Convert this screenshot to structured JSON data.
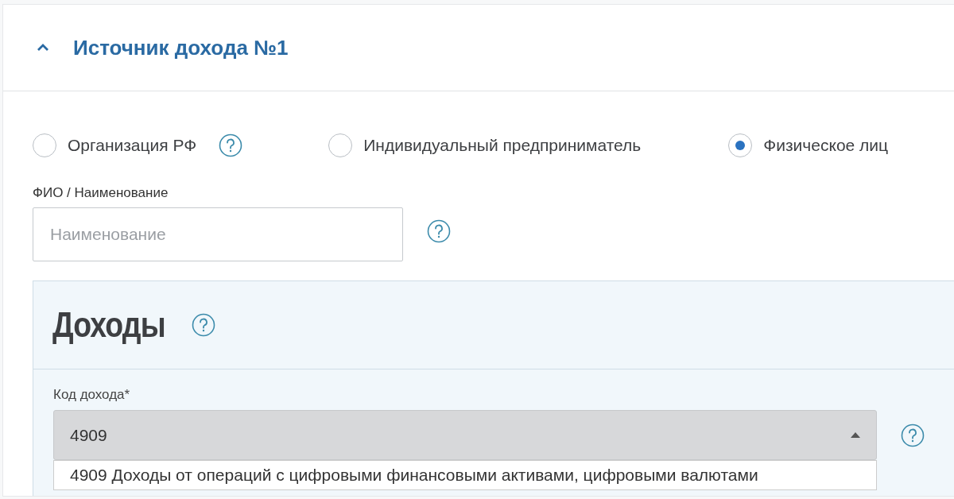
{
  "section": {
    "title": "Источник дохода №1",
    "expanded": true
  },
  "source_types": [
    {
      "label": "Организация РФ",
      "selected": false,
      "help": true
    },
    {
      "label": "Индивидуальный предприниматель",
      "selected": false,
      "help": false
    },
    {
      "label": "Физическое лиц",
      "selected": true,
      "help": false
    }
  ],
  "name_field": {
    "label": "ФИО / Наименование",
    "placeholder": "Наименование"
  },
  "income_panel": {
    "title": "Доходы",
    "code_label": "Код дохода*",
    "code_value": "4909",
    "dropdown_open": true,
    "options": [
      "4909 Доходы от операций с цифровыми финансовыми активами, цифровыми валютами"
    ]
  }
}
